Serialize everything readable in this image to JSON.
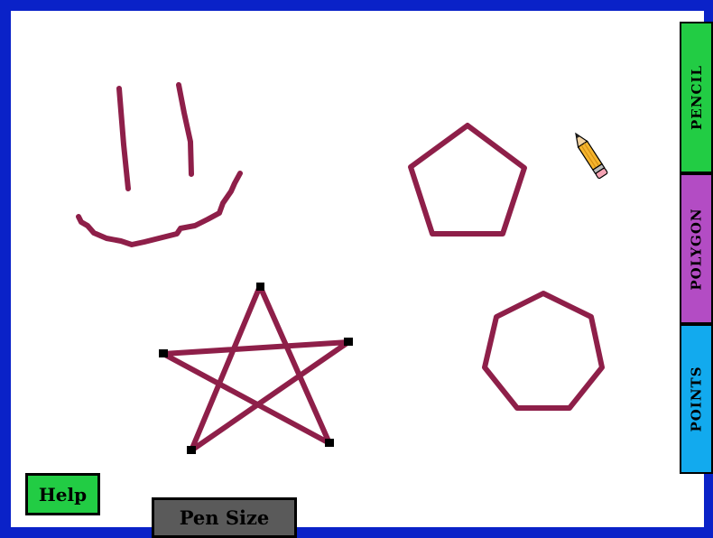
{
  "toolbar": {
    "tools": [
      {
        "label": "PENCIL",
        "color": "#22cc44"
      },
      {
        "label": "POLYGON",
        "color": "#b34cc4"
      },
      {
        "label": "POINTS",
        "color": "#12aaee"
      }
    ]
  },
  "buttons": {
    "help_label": "Help",
    "help_color": "#22cc44",
    "pen_size_label": "Pen Size",
    "pen_size_color": "#5a5a5a"
  },
  "canvas": {
    "frame_color": "#0a22c8",
    "background_color": "#ffffff",
    "stroke_color": "#8e1f49",
    "cursor_icon": "pencil-icon"
  }
}
